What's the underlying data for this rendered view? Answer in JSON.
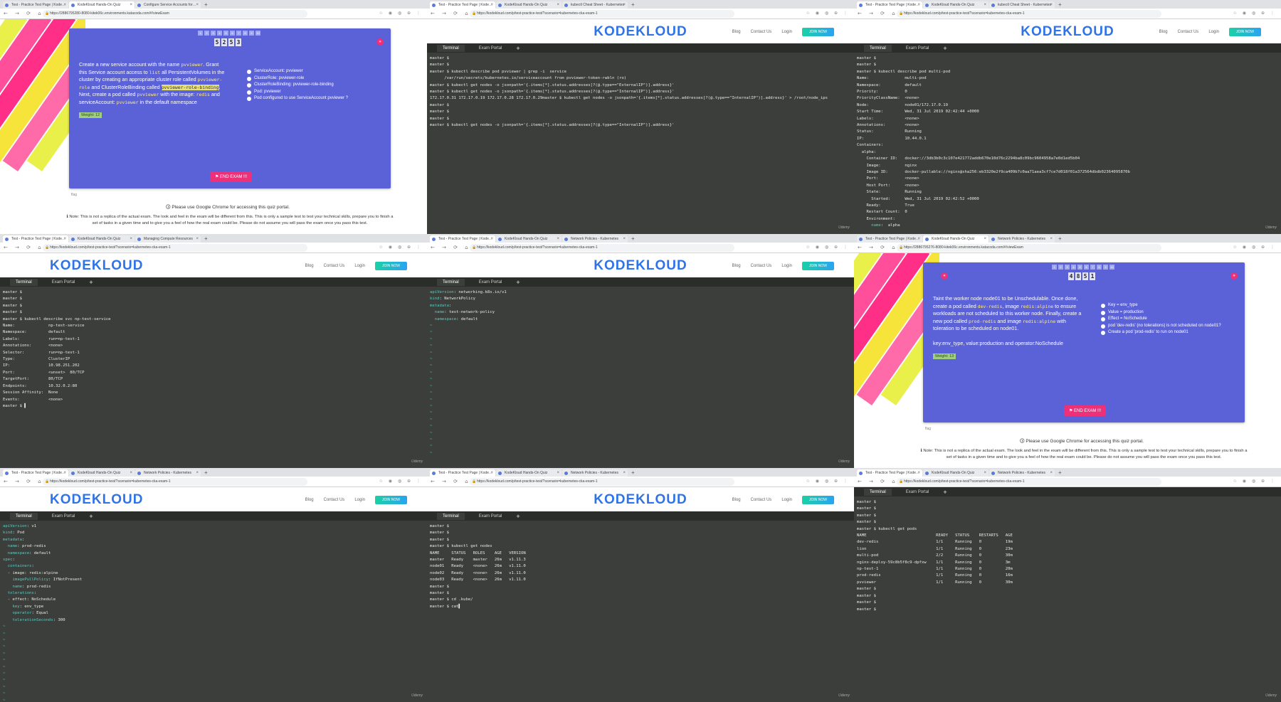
{
  "panels": [
    {
      "id": "p1",
      "type": "quiz",
      "tabs": [
        {
          "label": "Test - Practice Test Page | Kode…",
          "active": false
        },
        {
          "label": "KodeKloud Hands-On Quiz",
          "active": true
        },
        {
          "label": "Configure Service Accounts for…",
          "active": false
        }
      ],
      "url": "https://2886795280-8080-kitek06c.environments.katacoda.com/#/viewExam",
      "timer": [
        "5",
        "2",
        "5",
        "3"
      ],
      "question_html": "Create a new service account with the name <span class='hl'>pvviewer</span>. Grant this Service account access to <span class='hl'>list</span> all PersistentVolumes in the cluster by creating an appropriate cluster role called <span class='hl'>pvviewer-role</span> and ClusterRoleBinding called <span class='bhl'>pvviewer-role-binding</span>. Next, create a pod called <span class='hl'>pvviewer</span> with the image: <span class='hl'>redis</span> and serviceAccount: <span class='hl'>pvviewer</span> in the default namespace",
      "checks": [
        "ServiceAccount: pvviewer",
        "ClusterRole: pvviewer-role",
        "ClusterRoleBinding: pvviewer-role-binding",
        "Pod: pvviewer",
        "Pod configured to use ServiceAccount pvviewer ?"
      ],
      "weight": "Weight: 12",
      "end_button": "⚑ END EXAM !!!",
      "chrome_note": "🛈 Please use Google Chrome for accessing this quiz portal.",
      "disclaimer": "ℹ Note: This is not a replica of the actual exam. The look and feel in the exam will be different from this. This is only a sample test to test your technical skills, prepare you to finish a set of tasks in a given time and to give you a feel of how the real exam could be. Please do not assume you will pass the exam once you pass this test."
    },
    {
      "id": "p2",
      "type": "terminal",
      "tabs": [
        {
          "label": "Test - Practice Test Page | Kode…",
          "active": true
        },
        {
          "label": "KodeKloud Hands-On Quiz",
          "active": false
        },
        {
          "label": "kubectl Cheat Sheet - Kubernetes",
          "active": false
        }
      ],
      "url": "https://kodekloud.com/p/test-practice-test/?scenario=kubernetes-cka-exam-1"
    },
    {
      "id": "p3",
      "type": "terminal",
      "tabs": [
        {
          "label": "Test - Practice Test Page | Kode…",
          "active": true
        },
        {
          "label": "KodeKloud Hands-On Quiz",
          "active": false
        },
        {
          "label": "kubectl Cheat Sheet - Kubernetes",
          "active": false
        }
      ],
      "url": "https://kodekloud.com/p/test-practice-test/?scenario=kubernetes-cka-exam-1"
    },
    {
      "id": "p4",
      "type": "terminal",
      "tabs": [
        {
          "label": "Test - Practice Test Page | Kode…",
          "active": true
        },
        {
          "label": "KodeKloud Hands-On Quiz",
          "active": false
        },
        {
          "label": "Managing Compute Resources",
          "active": false
        }
      ],
      "url": "https://kodekloud.com/p/test-practice-test/?scenario=kubernetes-cka-exam-1"
    },
    {
      "id": "p5",
      "type": "terminal",
      "tabs": [
        {
          "label": "Test - Practice Test Page | Kode…",
          "active": true
        },
        {
          "label": "KodeKloud Hands-On Quiz",
          "active": false
        },
        {
          "label": "Network Policies - Kubernetes",
          "active": false
        }
      ],
      "url": "https://kodekloud.com/p/test-practice-test/?scenario=kubernetes-cka-exam-1"
    },
    {
      "id": "p6",
      "type": "quiz",
      "tabs": [
        {
          "label": "Test - Practice Test Page | Kode…",
          "active": false
        },
        {
          "label": "KodeKloud Hands-On Quiz",
          "active": true
        },
        {
          "label": "Network Policies - Kubernetes",
          "active": false
        }
      ],
      "url": "https://2886795276-8080-kitek06c.environments.katacoda.com/#/viewExam",
      "timer": [
        "4",
        "8",
        "5",
        "1"
      ],
      "question_html": "Taint the worker node node01 to be Unschedulable. Once done, create a pod called <span class='hl'>dev-redis</span>, image <span class='hl'>redis:alpine</span> to ensure workloads are not scheduled to this worker node. Finally, create a new pod called <span class='hl'>prod-redis</span> and image <span class='hl'>redis:alpine</span> with toleration to be scheduled on node01.<br><br>key:env_type, value:production and operator:NoSchedule",
      "checks": [
        "Key = env_type",
        "Value = production",
        "Effect = NoSchedule",
        "pod 'dev-redis' (no tolerations) is not scheduled on node01?",
        "Create a pod 'prod-redis' to run on node01"
      ],
      "weight": "Weight: 13",
      "end_button": "⚑ END EXAM !!!",
      "chrome_note": "🛈 Please use Google Chrome for accessing this quiz portal.",
      "disclaimer": "ℹ Note: This is not a replica of the actual exam. The look and feel in the exam will be different from this. This is only a sample test to test your technical skills, prepare you to finish a set of tasks in a given time and to give you a feel of how the real exam could be. Please do not assume you will pass the exam once you pass this test."
    },
    {
      "id": "p7",
      "type": "terminal",
      "tabs": [
        {
          "label": "Test - Practice Test Page | Kode…",
          "active": true
        },
        {
          "label": "KodeKloud Hands-On Quiz",
          "active": false
        },
        {
          "label": "Network Policies - Kubernetes",
          "active": false
        }
      ],
      "url": "https://kodekloud.com/p/test-practice-test/?scenario=kubernetes-cka-exam-1"
    },
    {
      "id": "p8",
      "type": "terminal",
      "tabs": [
        {
          "label": "Test - Practice Test Page | Kode…",
          "active": true
        },
        {
          "label": "KodeKloud Hands-On Quiz",
          "active": false
        },
        {
          "label": "Network Policies - Kubernetes",
          "active": false
        }
      ],
      "url": "https://kodekloud.com/p/test-practice-test/?scenario=kubernetes-cka-exam-1"
    },
    {
      "id": "p9",
      "type": "terminal",
      "tabs": [
        {
          "label": "Test - Practice Test Page | Kode…",
          "active": true
        },
        {
          "label": "KodeKloud Hands-On Quiz",
          "active": false
        },
        {
          "label": "Network Policies - Kubernetes",
          "active": false
        }
      ],
      "url": "https://kodekloud.com/p/test-practice-test/?scenario=kubernetes-cka-exam-1"
    }
  ],
  "kk": {
    "logo": "KODEKLOUD",
    "blog": "Blog",
    "contact": "Contact Us",
    "login": "Login",
    "join": "JOIN NOW"
  },
  "terminal_ui": {
    "tab_terminal": "Terminal",
    "tab_exam": "Exam Portal",
    "plus": "+",
    "watermark": "Udemy"
  },
  "terms": {
    "p2": [
      "master $",
      "master $",
      "master $ kubectl describe pod pvviewer | grep -i  service",
      "      /var/run/secrets/kubernetes.io/serviceaccount from pvviewer-token-rwbln (ro)",
      "master $ kubectl get nodes -o jsonpath='{.items[*].status.addresses[?(@.type==\"ExternalIP\")].address}'",
      "master $ kubectl get nodes -o jsonpath='{.items[*].status.addresses[?(@.type==\"InternalIP\")].address}'",
      "172.17.0.31 172.17.0.19 172.17.0.28 172.17.0.29master $ kubectl get nodes -o jsonpath='{.items[*].status.addresses[?(@.type==\"InternalIP\")].address}' > /root/node_ips",
      "master $",
      "master $",
      "master $",
      "master $ kubectl get nodes -o jsonpath='{.items[*].status.addresses[?(@.type==\"InternalIP\")].address}'"
    ],
    "p3": [
      "master $",
      "master $",
      "master $ kubectl describe pod multi-pod",
      "Name:               multi-pod",
      "Namespace:          default",
      "Priority:           0",
      "PriorityClassName:  <none>",
      "Node:               node01/172.17.0.19",
      "Start Time:         Wed, 31 Jul 2019 02:42:44 +0000",
      "Labels:             <none>",
      "Annotations:        <none>",
      "Status:             Running",
      "IP:                 10.44.0.1",
      "Containers:",
      "  alpha:",
      "    Container ID:   docker://3db3b0c3c107e421772addb670e10d76c2294ba8c09bc9604958a7e0d1ed5b04",
      "    Image:          nginx",
      "    Image ID:       docker-pullable://nginx@sha256:eb3320e2f9ca409b7c0aa71aea3cf7ce7d018f01a372564dbdb02364095870b",
      "    Port:           <none>",
      "    Host Port:      <none>",
      "    State:          Running",
      "      Started:      Wed, 31 Jul 2019 02:42:52 +0000",
      "    Ready:          True",
      "    Restart Count:  0",
      "    Environment:",
      "      name:  alpha"
    ],
    "p4": [
      "master $",
      "master $",
      "master $",
      "master $",
      "master $ kubectl describe svc np-test-service",
      "Name:              np-test-service",
      "Namespace:         default",
      "Labels:            run=np-test-1",
      "Annotations:       <none>",
      "Selector:          run=np-test-1",
      "Type:              ClusterIP",
      "IP:                10.98.251.202",
      "Port:              <unset>  80/TCP",
      "TargetPort:        80/TCP",
      "Endpoints:         10.32.0.2:80",
      "Session Affinity:  None",
      "Events:            <none>",
      "master $ ▌"
    ],
    "p5": [
      "apiVersion: networking.k8s.io/v1",
      "kind: NetworkPolicy",
      "metadata:",
      "  name: test-network-policy",
      "  namespace: default",
      "~",
      "~",
      "~",
      "~",
      "~",
      "~",
      "~",
      "~",
      "~",
      "~",
      "~",
      "~",
      "~",
      "~",
      "~",
      "~",
      "~",
      "~",
      "~",
      "~"
    ],
    "p7": [
      "apiVersion: v1",
      "kind: Pod",
      "metadata:",
      "  name: prod-redis",
      "  namespace: default",
      "spec:",
      "  containers:",
      "  - image: redis:alpine",
      "    imagePullPolicy: IfNotPresent",
      "    name: prod-redis",
      "  tolerations:",
      "  - effect: NoSchedule",
      "    key: env_type",
      "    operator: Equal",
      "    tolerationSeconds: 300",
      "~",
      "~",
      "~",
      "~",
      "~",
      "~",
      "~",
      "~",
      "~",
      "~",
      "~",
      "~"
    ],
    "p8": [
      "master $",
      "master $",
      "master $",
      "master $ kubectl get nodes",
      "NAME     STATUS   ROLES    AGE   VERSION",
      "master   Ready    master   26m   v1.11.3",
      "node01   Ready    <none>   26m   v1.11.0",
      "node02   Ready    <none>   26m   v1.11.0",
      "node03   Ready    <none>   26m   v1.11.0",
      "master $",
      "master $",
      "master $ cd .kube/",
      "master $ cat▌"
    ],
    "p9": [
      "master $",
      "master $",
      "master $",
      "master $",
      "master $ kubectl get pods",
      "NAME                             READY   STATUS    RESTARTS   AGE",
      "dev-redis                        1/1     Running   0          19m",
      "lion                             1/1     Running   0          23m",
      "multi-pod                        2/2     Running   0          30m",
      "nginx-deploy-59c8b5f8c9-dpfxw    1/1     Running   0          3m",
      "np-test-1                        1/1     Running   0          20m",
      "prod-redis                       1/1     Running   0          16m",
      "pvviewer                         1/1     Running   0          30m",
      "master $",
      "master $",
      "master $",
      "master $"
    ]
  }
}
